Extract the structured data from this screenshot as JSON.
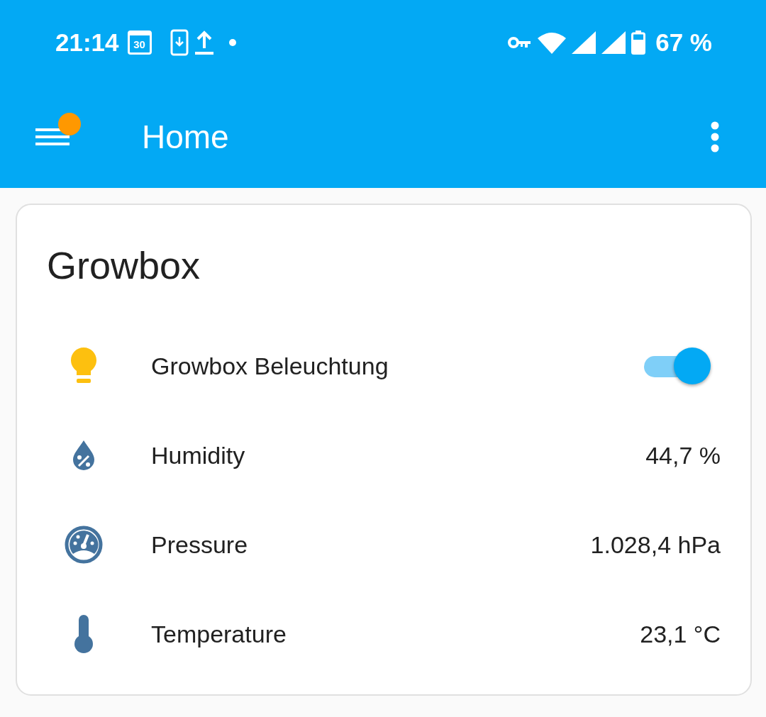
{
  "status_bar": {
    "time": "21:14",
    "calendar_day": "30",
    "battery": "67 %"
  },
  "app_bar": {
    "title": "Home",
    "notification_badge": true
  },
  "card": {
    "title": "Growbox",
    "rows": [
      {
        "kind": "light",
        "label": "Growbox Beleuchtung",
        "on": true
      },
      {
        "kind": "humidity",
        "label": "Humidity",
        "value": "44,7 %"
      },
      {
        "kind": "pressure",
        "label": "Pressure",
        "value": "1.028,4 hPa"
      },
      {
        "kind": "temperature",
        "label": "Temperature",
        "value": "23,1 °C"
      }
    ]
  }
}
